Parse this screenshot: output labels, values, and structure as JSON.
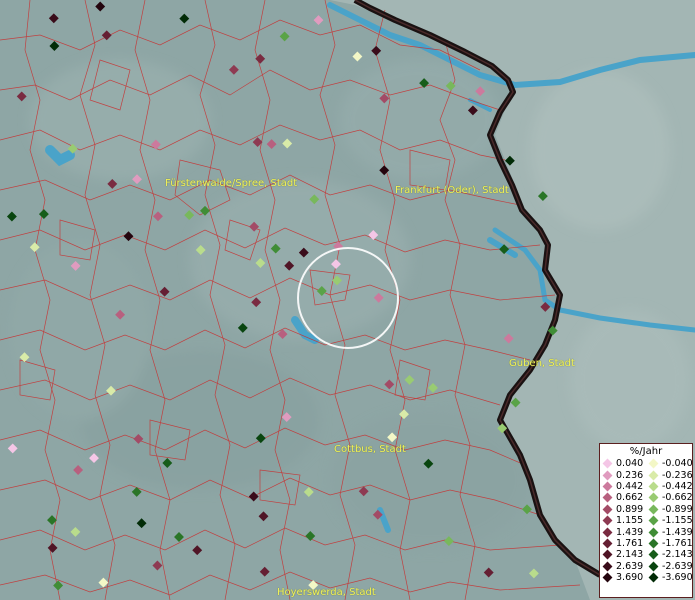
{
  "cities": [
    {
      "id": "fuerstenwalde",
      "name": "Fürstenwalde/Spree, Stadt"
    },
    {
      "id": "frankfurt",
      "name": "Frankfurt (Oder), Stadt"
    },
    {
      "id": "guben",
      "name": "Guben, Stadt"
    },
    {
      "id": "cottbus",
      "name": "Cottbus, Stadt"
    },
    {
      "id": "hoyerswerda",
      "name": "Hoyerswerda, Stadt"
    }
  ],
  "legend": {
    "title": "%/Jahr",
    "positive": [
      {
        "label": "0.040",
        "color": "#f4c6e6"
      },
      {
        "label": "0.236",
        "color": "#e09bbf"
      },
      {
        "label": "0.442",
        "color": "#cc7a9d"
      },
      {
        "label": "0.662",
        "color": "#b8607f"
      },
      {
        "label": "0.899",
        "color": "#a34b66"
      },
      {
        "label": "1.155",
        "color": "#8e3a52"
      },
      {
        "label": "1.439",
        "color": "#7a2b41"
      },
      {
        "label": "1.761",
        "color": "#651f33"
      },
      {
        "label": "2.143",
        "color": "#501526"
      },
      {
        "label": "2.639",
        "color": "#3a0c1a"
      },
      {
        "label": "3.690",
        "color": "#24050e"
      }
    ],
    "negative": [
      {
        "label": "-0.040",
        "color": "#f3f7c6"
      },
      {
        "label": "-0.236",
        "color": "#d9eba8"
      },
      {
        "label": "-0.442",
        "color": "#b9dc8c"
      },
      {
        "label": "-0.662",
        "color": "#99cb72"
      },
      {
        "label": "-0.899",
        "color": "#78b85c"
      },
      {
        "label": "-1.155",
        "color": "#5aa347"
      },
      {
        "label": "-1.439",
        "color": "#408d36"
      },
      {
        "label": "-1.761",
        "color": "#2a7527"
      },
      {
        "label": "-2.143",
        "color": "#175d1a"
      },
      {
        "label": "-2.639",
        "color": "#09450f"
      },
      {
        "label": "-3.690",
        "color": "#022c07"
      }
    ]
  },
  "points": [
    {
      "v": 0.662
    },
    {
      "v": -0.662
    },
    {
      "v": 1.439
    },
    {
      "v": -1.761
    },
    {
      "v": 0.442
    },
    {
      "v": -2.143
    },
    {
      "v": 2.639
    },
    {
      "v": -0.236
    },
    {
      "v": 0.899
    },
    {
      "v": -1.155
    },
    {
      "v": 1.761
    },
    {
      "v": -0.442
    },
    {
      "v": 0.236
    },
    {
      "v": -2.639
    },
    {
      "v": 3.69
    },
    {
      "v": -0.04
    },
    {
      "v": 1.155
    },
    {
      "v": -0.899
    },
    {
      "v": 0.04
    },
    {
      "v": -1.439
    },
    {
      "v": 2.143
    },
    {
      "v": -3.69
    },
    {
      "v": 0.662
    },
    {
      "v": -0.662
    },
    {
      "v": 1.439
    },
    {
      "v": -0.236
    },
    {
      "v": 0.899
    },
    {
      "v": -1.761
    },
    {
      "v": 2.639
    },
    {
      "v": -0.442
    },
    {
      "v": 0.442
    },
    {
      "v": -2.143
    },
    {
      "v": 1.761
    },
    {
      "v": -1.155
    },
    {
      "v": 0.236
    },
    {
      "v": -0.899
    },
    {
      "v": 3.69
    },
    {
      "v": -0.04
    },
    {
      "v": 1.155
    },
    {
      "v": -2.639
    },
    {
      "v": 0.04
    },
    {
      "v": -1.439
    },
    {
      "v": 2.143
    },
    {
      "v": -0.662
    },
    {
      "v": 0.662
    },
    {
      "v": -3.69
    },
    {
      "v": 1.439
    },
    {
      "v": -0.236
    },
    {
      "v": 0.899
    },
    {
      "v": -1.761
    },
    {
      "v": 2.639
    },
    {
      "v": -0.442
    },
    {
      "v": 0.442
    },
    {
      "v": -1.155
    },
    {
      "v": 1.761
    },
    {
      "v": -2.143
    },
    {
      "v": 0.236
    },
    {
      "v": -0.899
    },
    {
      "v": 3.69
    },
    {
      "v": -0.04
    },
    {
      "v": 1.155
    },
    {
      "v": -1.439
    },
    {
      "v": 0.04
    },
    {
      "v": -2.639
    },
    {
      "v": 2.143
    },
    {
      "v": -0.662
    },
    {
      "v": 0.662
    },
    {
      "v": -3.69
    },
    {
      "v": 1.439
    },
    {
      "v": -0.236
    },
    {
      "v": 0.899
    },
    {
      "v": -1.761
    },
    {
      "v": 2.639
    },
    {
      "v": -0.442
    },
    {
      "v": 0.442
    },
    {
      "v": -1.155
    },
    {
      "v": 1.761
    },
    {
      "v": -2.143
    },
    {
      "v": 0.236
    },
    {
      "v": -0.899
    },
    {
      "v": -0.04
    },
    {
      "v": 1.155
    },
    {
      "v": -1.439
    },
    {
      "v": 0.04
    },
    {
      "v": -2.639
    },
    {
      "v": 2.143
    },
    {
      "v": -0.662
    },
    {
      "v": 0.662
    },
    {
      "v": -3.69
    },
    {
      "v": 1.439
    },
    {
      "v": -0.236
    },
    {
      "v": 0.899
    },
    {
      "v": -1.761
    },
    {
      "v": 2.639
    },
    {
      "v": -0.442
    },
    {
      "v": 0.442
    }
  ]
}
